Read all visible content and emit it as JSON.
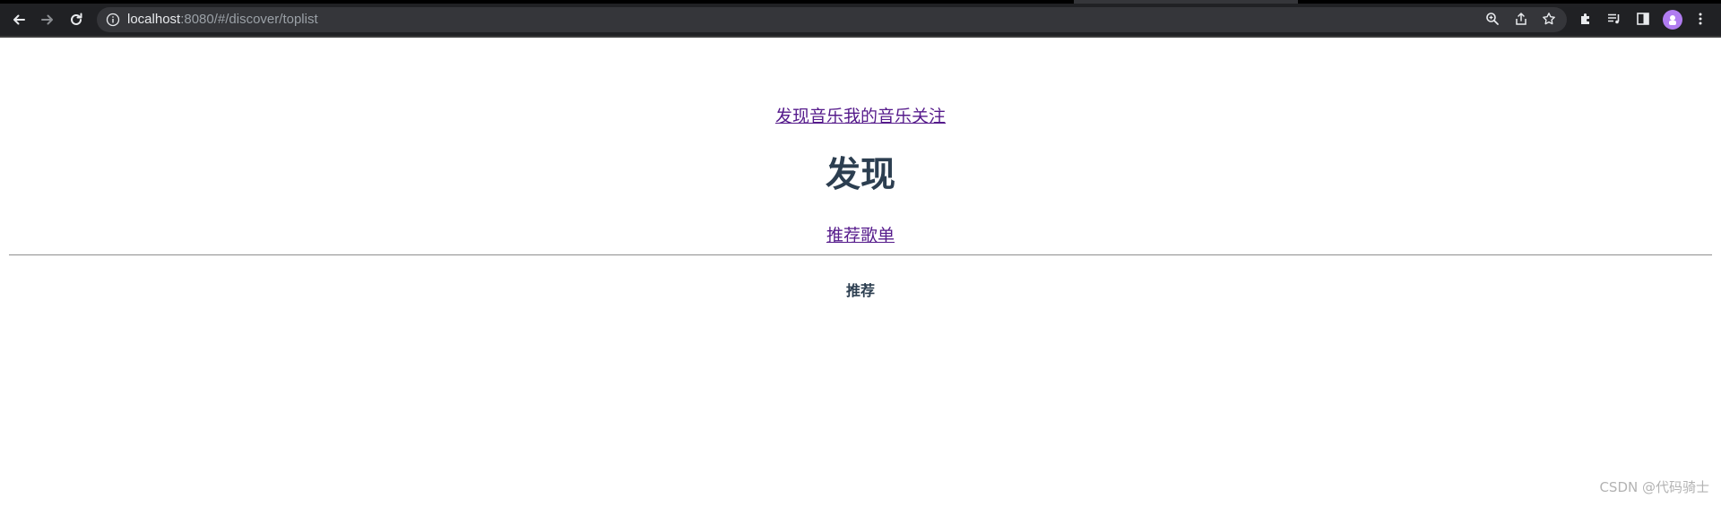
{
  "browser": {
    "url_host": "localhost",
    "url_rest": ":8080/#/discover/toplist",
    "icons": [
      "back-arrow-icon",
      "forward-arrow-icon",
      "reload-icon",
      "info-icon",
      "zoom-icon",
      "share-icon",
      "star-icon",
      "extensions-icon",
      "reading-list-icon",
      "side-panel-icon",
      "profile-avatar",
      "menu-icon"
    ]
  },
  "nav": {
    "items": [
      {
        "label": "发现音乐"
      },
      {
        "label": "我的音乐"
      },
      {
        "label": "关注"
      }
    ]
  },
  "page": {
    "title": "发现",
    "subnav_label": "推荐歌单",
    "section_title": "推荐"
  },
  "watermark": "CSDN @代码骑士",
  "colors": {
    "chrome_bg": "#202124",
    "omnibox_bg": "#35363a",
    "link": "#551a8b",
    "text": "#2c3e50",
    "avatar": "#b07cf0"
  }
}
